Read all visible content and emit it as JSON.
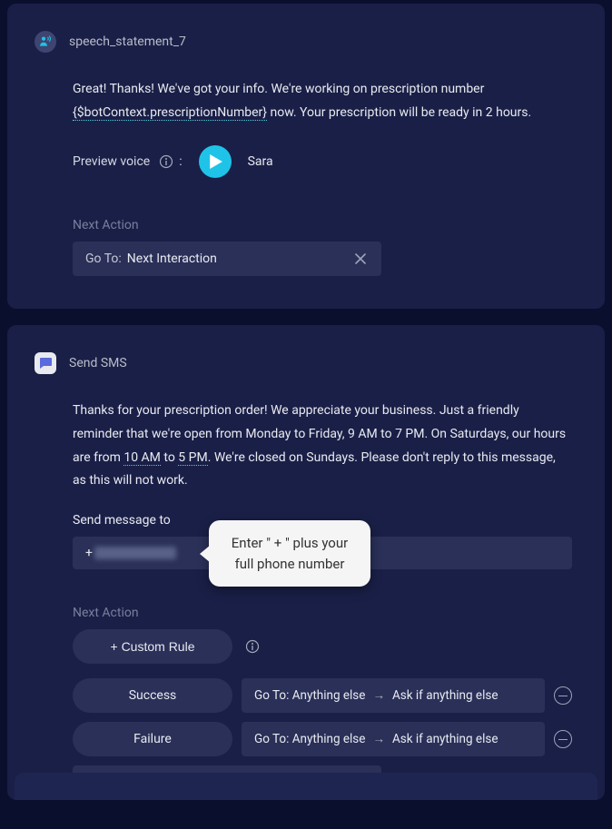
{
  "card1": {
    "title": "speech_statement_7",
    "body_pre": "Great! Thanks! We've got your info. We're working on prescription number ",
    "variable": "{$botContext.prescriptionNumber}",
    "body_post": " now. Your prescription will be ready in 2 hours.",
    "preview_label": "Preview voice",
    "voice_name": "Sara",
    "next_action_label": "Next Action",
    "goto_prefix": "Go To:",
    "goto_value": "Next Interaction"
  },
  "card2": {
    "title": "Send SMS",
    "body_pre": "Thanks for your prescription order! We appreciate your business. Just a friendly reminder that we're open from Monday to Friday, 9 AM to 7 PM. On Saturdays, our hours are from ",
    "time1": "10 AM",
    "body_mid": " to ",
    "time2": "5 PM",
    "body_post": ". We're closed on Sundays. Please don't reply to this message, as this will not work.",
    "send_to_label": "Send message to",
    "phone_prefix": "+",
    "tooltip_text": "Enter \" + \" plus your full phone number",
    "next_action_label": "Next Action",
    "custom_rule": "+ Custom Rule",
    "success": "Success",
    "failure": "Failure",
    "goto_anything": "Go To: Anything else",
    "ask_anything": "Ask if anything else"
  }
}
